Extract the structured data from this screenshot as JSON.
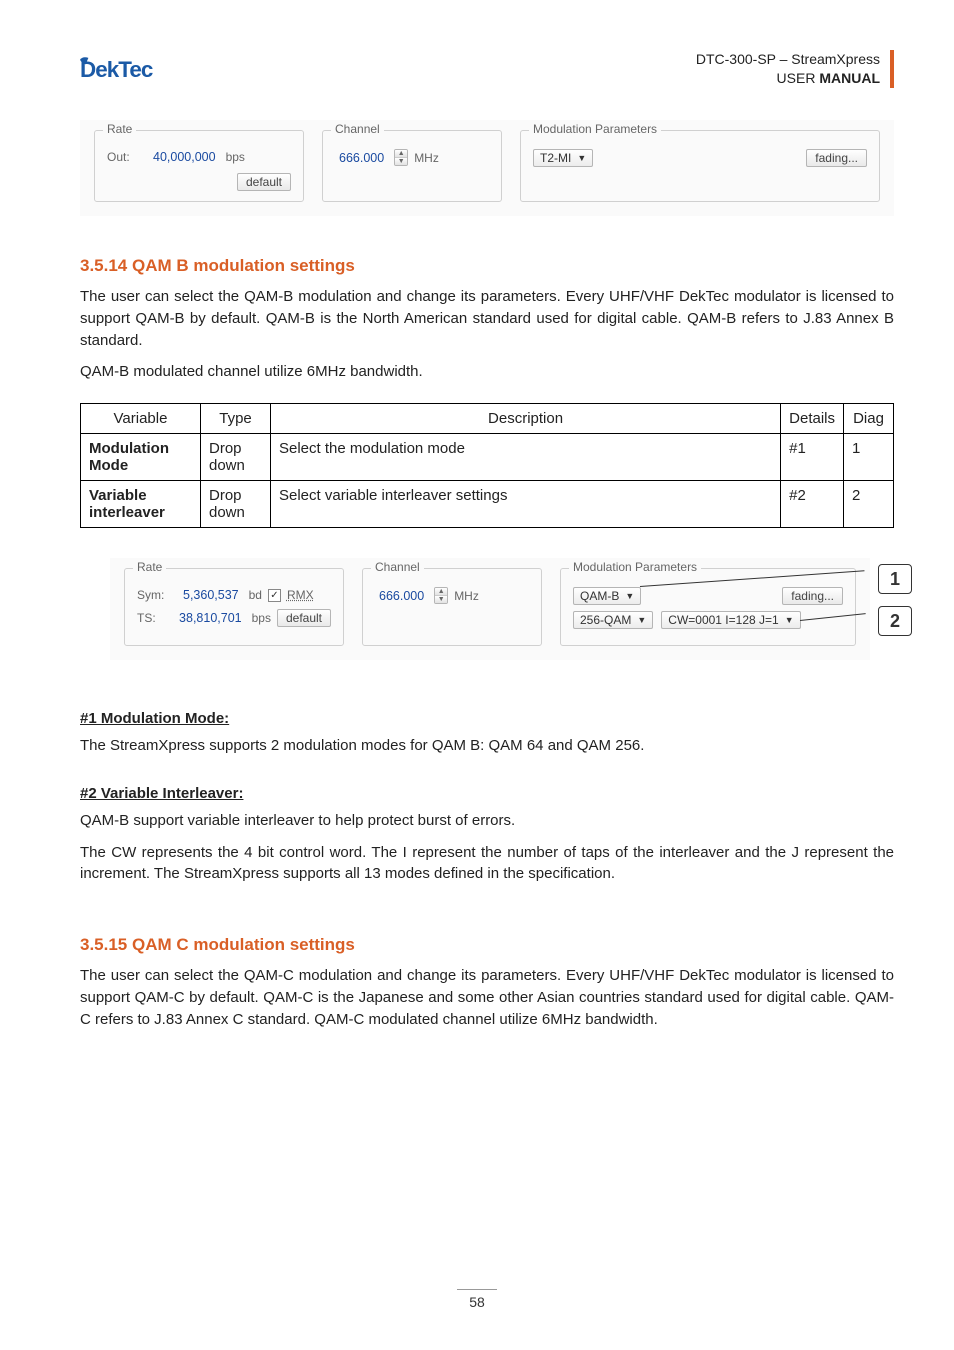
{
  "header": {
    "doc_id": "DTC-300-SP – StreamXpress",
    "doc_type_pre": "USER ",
    "doc_type_b": "MANUAL"
  },
  "panel1": {
    "rate_legend": "Rate",
    "channel_legend": "Channel",
    "mod_legend": "Modulation Parameters",
    "out_label": "Out:",
    "out_value": "40,000,000",
    "out_unit": "bps",
    "default_btn": "default",
    "chan_value": "666.000",
    "chan_unit": "MHz",
    "mod_value": "T2-MI",
    "fading_btn": "fading..."
  },
  "section1": {
    "heading": "3.5.14 QAM B modulation settings",
    "para1": "The user can select the QAM-B modulation and change its parameters. Every UHF/VHF DekTec modulator is licensed to support QAM-B by default. QAM-B is the North American standard used for digital cable. QAM-B refers to J.83 Annex B standard.",
    "para2": "QAM-B modulated channel utilize 6MHz bandwidth."
  },
  "table": {
    "h_variable": "Variable",
    "h_type": "Type",
    "h_desc": "Description",
    "h_details": "Details",
    "h_diag": "Diag",
    "rows": [
      {
        "variable": "Modulation Mode",
        "type": "Drop down",
        "desc": "Select the modulation mode",
        "details": "#1",
        "diag": "1"
      },
      {
        "variable": "Variable interleaver",
        "type": "Drop down",
        "desc": "Select variable interleaver settings",
        "details": "#2",
        "diag": "2"
      }
    ]
  },
  "panel2": {
    "rate_legend": "Rate",
    "channel_legend": "Channel",
    "mod_legend": "Modulation Parameters",
    "sym_label": "Sym:",
    "sym_value": "5,360,537",
    "sym_unit": "bd",
    "rmx_label": "RMX",
    "ts_label": "TS:",
    "ts_value": "38,810,701",
    "ts_unit": "bps",
    "default_btn": "default",
    "chan_value": "666.000",
    "chan_unit": "MHz",
    "qam_b": "QAM-B",
    "fading_btn": "fading...",
    "qam256": "256-QAM",
    "cw": "CW=0001  I=128  J=1",
    "callout1": "1",
    "callout2": "2"
  },
  "detail1": {
    "head": "#1 Modulation Mode:",
    "text": "The StreamXpress supports 2 modulation modes for QAM B: QAM 64 and QAM 256."
  },
  "detail2": {
    "head": "#2 Variable Interleaver:",
    "text1": "QAM-B support variable interleaver to help protect burst of errors.",
    "text2": "The CW represents the 4 bit control word. The I represent the number of taps of the interleaver and the J represent the increment. The StreamXpress supports all 13 modes defined in the specification."
  },
  "section2": {
    "heading": "3.5.15 QAM C modulation settings",
    "para1": "The user can select the QAM-C modulation and change its parameters. Every UHF/VHF DekTec modulator is licensed to support QAM-C by default. QAM-C is the Japanese and some other Asian countries standard used for digital cable. QAM-C refers to J.83 Annex C standard. QAM-C modulated channel utilize 6MHz bandwidth."
  },
  "page_number": "58"
}
